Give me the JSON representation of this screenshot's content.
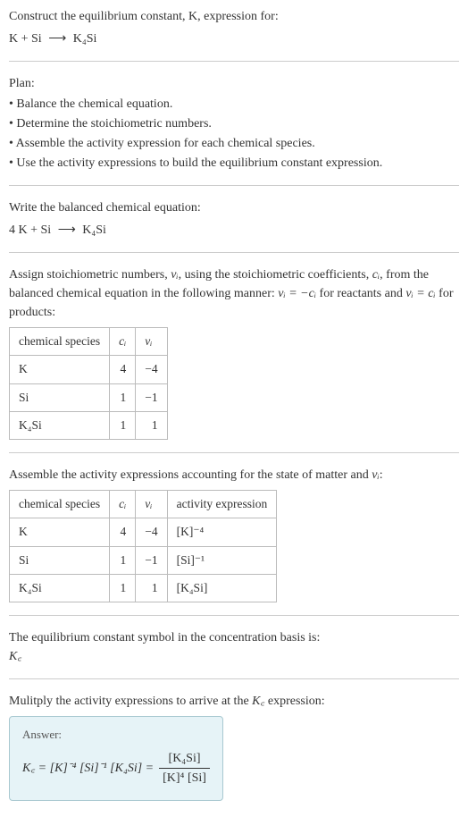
{
  "header": {
    "prompt_line1": "Construct the equilibrium constant, K, expression for:",
    "prompt_eq_lhs": "K + Si",
    "arrow": "⟶",
    "prompt_eq_rhs": "K₄Si"
  },
  "plan": {
    "title": "Plan:",
    "items": [
      "• Balance the chemical equation.",
      "• Determine the stoichiometric numbers.",
      "• Assemble the activity expression for each chemical species.",
      "• Use the activity expressions to build the equilibrium constant expression."
    ]
  },
  "balanced": {
    "title": "Write the balanced chemical equation:",
    "eq_lhs": "4 K + Si",
    "arrow": "⟶",
    "eq_rhs": "K₄Si"
  },
  "stoich": {
    "intro_a": "Assign stoichiometric numbers, ",
    "nu_i": "νᵢ",
    "intro_b": ", using the stoichiometric coefficients, ",
    "c_i": "cᵢ",
    "intro_c": ", from the balanced chemical equation in the following manner: ",
    "rel1": "νᵢ = −cᵢ",
    "intro_d": " for reactants and ",
    "rel2": "νᵢ = cᵢ",
    "intro_e": " for products:",
    "headers": {
      "species": "chemical species",
      "ci": "cᵢ",
      "vi": "νᵢ"
    },
    "rows": [
      {
        "species": "K",
        "ci": "4",
        "vi": "−4"
      },
      {
        "species": "Si",
        "ci": "1",
        "vi": "−1"
      },
      {
        "species": "K₄Si",
        "ci": "1",
        "vi": "1"
      }
    ]
  },
  "activity": {
    "intro_a": "Assemble the activity expressions accounting for the state of matter and ",
    "nu_i": "νᵢ",
    "intro_b": ":",
    "headers": {
      "species": "chemical species",
      "ci": "cᵢ",
      "vi": "νᵢ",
      "ae": "activity expression"
    },
    "rows": [
      {
        "species": "K",
        "ci": "4",
        "vi": "−4",
        "ae": "[K]⁻⁴"
      },
      {
        "species": "Si",
        "ci": "1",
        "vi": "−1",
        "ae": "[Si]⁻¹"
      },
      {
        "species": "K₄Si",
        "ci": "1",
        "vi": "1",
        "ae": "[K₄Si]"
      }
    ]
  },
  "symbol": {
    "line": "The equilibrium constant symbol in the concentration basis is:",
    "kc": "K꜀"
  },
  "multiply": {
    "intro_a": "Mulitply the activity expressions to arrive at the ",
    "kc": "K꜀",
    "intro_b": " expression:"
  },
  "answer": {
    "label": "Answer:",
    "lhs": "K꜀ = [K]⁻⁴ [Si]⁻¹ [K₄Si] =",
    "num": "[K₄Si]",
    "den": "[K]⁴ [Si]"
  }
}
